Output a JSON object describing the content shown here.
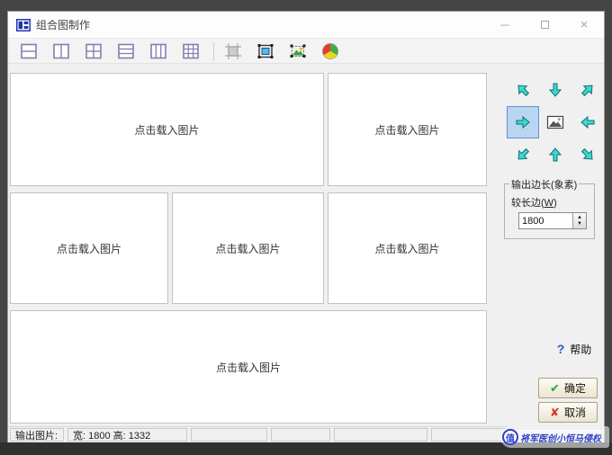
{
  "window": {
    "title": "组合图制作",
    "controls": {
      "minimize": "─",
      "close": "×"
    }
  },
  "toolbar": {
    "layout_icons": [
      {
        "name": "layout-2-rows"
      },
      {
        "name": "layout-2-columns"
      },
      {
        "name": "layout-2x2-grid"
      },
      {
        "name": "layout-3-rows"
      },
      {
        "name": "layout-3-columns"
      },
      {
        "name": "layout-3x3-grid"
      }
    ],
    "tool_icons": [
      {
        "name": "crop-frame-disabled"
      },
      {
        "name": "border-frame"
      },
      {
        "name": "image-selection"
      },
      {
        "name": "color-wheel"
      }
    ]
  },
  "canvas": {
    "placeholder": "点击载入图片",
    "cell_count": 6
  },
  "direction_pad": {
    "selected": "right",
    "directions": [
      "up-left",
      "down",
      "up-right",
      "right",
      "image-preview",
      "left",
      "down-left",
      "up",
      "down-right"
    ],
    "arrow_color": "#40d8cc"
  },
  "output_group": {
    "title": "输出边长(象素)",
    "label_pre": "较长边(",
    "label_mnemonic": "W",
    "label_post": ")",
    "value": "1800"
  },
  "actions": {
    "help_icon": "?",
    "help": "帮助",
    "ok_icon": "✔",
    "ok": "确定",
    "cancel_icon": "✘",
    "cancel": "取消"
  },
  "statusbar": {
    "label": "输出图片:",
    "size": "宽: 1800 高: 1332"
  },
  "watermark": {
    "logo": "值",
    "text": "将军医创小恒马侵权"
  }
}
